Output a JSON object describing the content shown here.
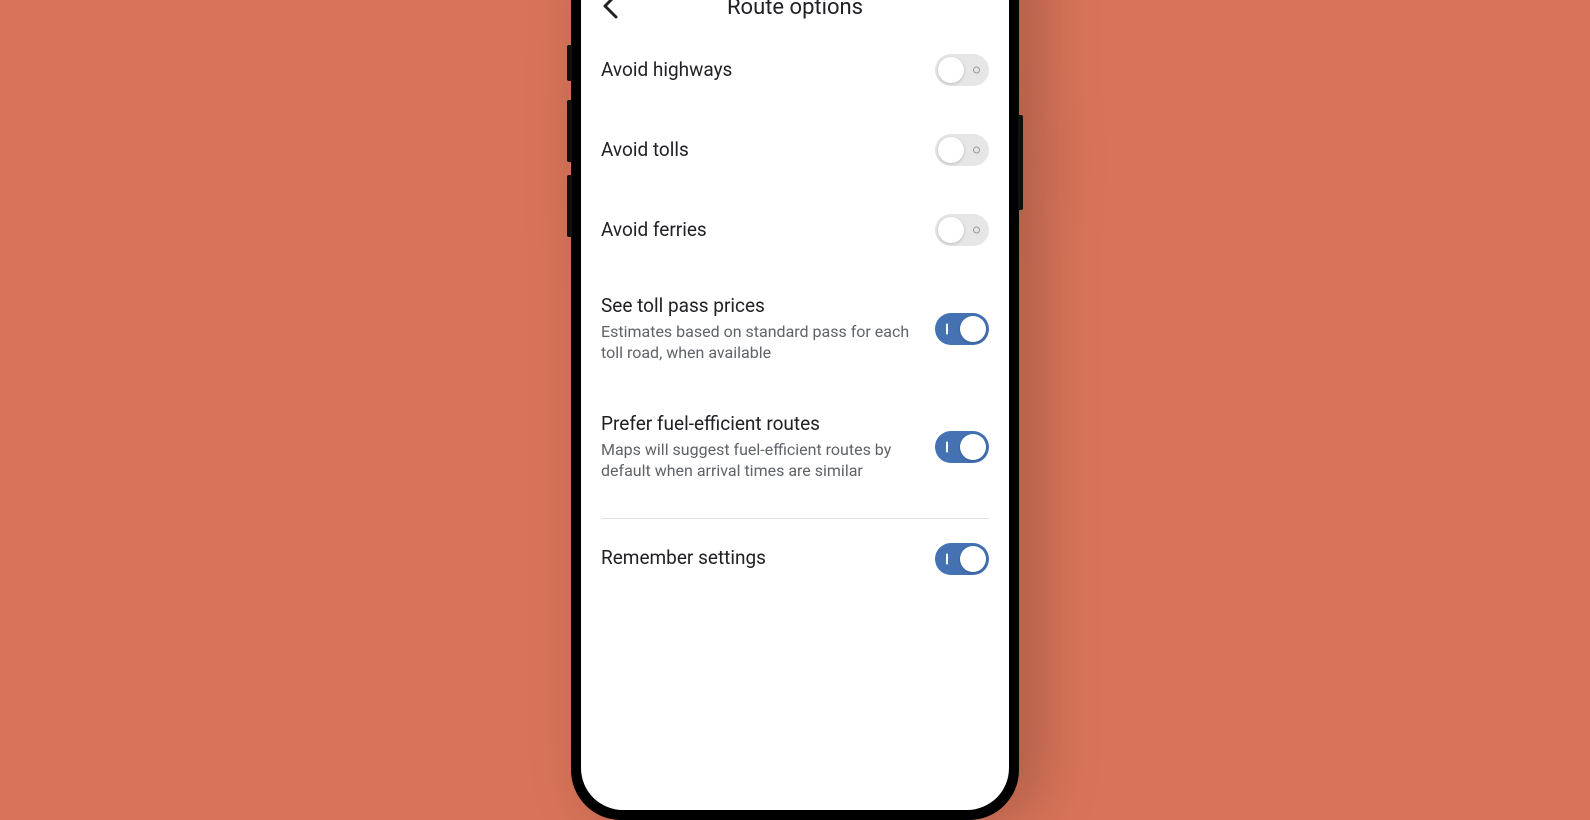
{
  "header": {
    "title": "Route options"
  },
  "options": [
    {
      "label": "Avoid highways",
      "sub": "",
      "on": false,
      "name": "avoid-highways"
    },
    {
      "label": "Avoid tolls",
      "sub": "",
      "on": false,
      "name": "avoid-tolls"
    },
    {
      "label": "Avoid ferries",
      "sub": "",
      "on": false,
      "name": "avoid-ferries"
    },
    {
      "label": "See toll pass prices",
      "sub": "Estimates based on standard pass for each toll road, when available",
      "on": true,
      "name": "see-toll-pass-prices"
    },
    {
      "label": "Prefer fuel-efficient routes",
      "sub": "Maps will suggest fuel-efficient routes by default when arrival times are similar",
      "on": true,
      "name": "prefer-fuel-efficient"
    }
  ],
  "remember": {
    "label": "Remember settings",
    "on": true
  }
}
